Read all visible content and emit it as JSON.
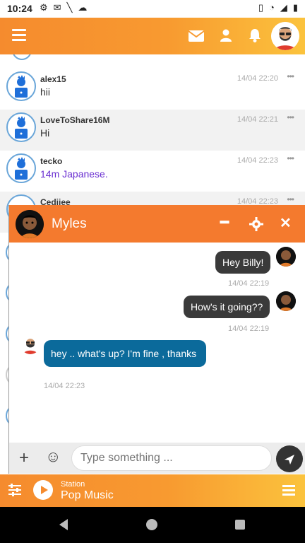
{
  "status_bar": {
    "time": "10:24"
  },
  "chat_list": [
    {
      "user": "alex15",
      "text": "hii",
      "time": "14/04 22:20",
      "dots": "•••"
    },
    {
      "user": "LoveToShare16M",
      "text": "Hi",
      "time": "14/04 22:21",
      "dots": "•••"
    },
    {
      "user": "tecko",
      "text": "14m Japanese.",
      "time": "14/04 22:23",
      "dots": "•••"
    },
    {
      "user": "Cedjiee",
      "text": "",
      "time": "14/04 22:23",
      "dots": "•••"
    }
  ],
  "pm": {
    "name": "Myles",
    "messages": [
      {
        "text": "Hey Billy!",
        "time": "14/04 22:19"
      },
      {
        "text": "How's it going??",
        "time": "14/04 22:19"
      },
      {
        "text": "hey .. what's up? I'm fine , thanks",
        "time": "14/04 22:23"
      }
    ],
    "input_placeholder": "Type something ..."
  },
  "player": {
    "label": "Station",
    "name": "Pop Music"
  },
  "colors": {
    "accent": "#f47a2e",
    "bubble_in": "#0b6a9b",
    "bubble_out": "#3a3a3a"
  }
}
